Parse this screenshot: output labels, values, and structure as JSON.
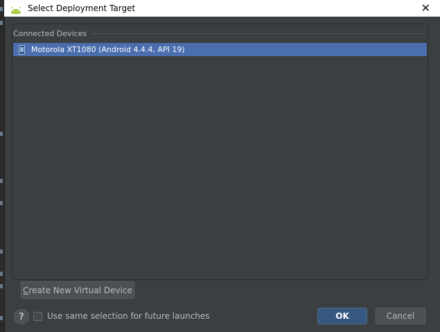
{
  "dialog": {
    "title": "Select Deployment Target",
    "close_glyph": "✕"
  },
  "devices": {
    "section_label": "Connected Devices",
    "items": [
      {
        "label": "Motorola XT1080 (Android 4.4.4, API 19)",
        "selected": true,
        "icon": "phone-icon"
      }
    ]
  },
  "actions": {
    "create_prefix": "C",
    "create_rest": "reate New Virtual Device",
    "help_glyph": "?",
    "checkbox_label": "Use same selection for future launches",
    "checkbox_checked": false,
    "ok_label": "OK",
    "cancel_label": "Cancel"
  },
  "colors": {
    "dialog_bg": "#3c3f41",
    "selection": "#4b6eaf",
    "primary_button": "#365880",
    "android_green": "#a4c639"
  }
}
